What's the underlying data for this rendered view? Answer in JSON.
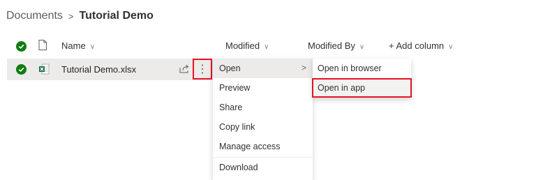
{
  "breadcrumb": {
    "root": "Documents",
    "separator": ">",
    "current": "Tutorial Demo"
  },
  "columns": {
    "name": "Name",
    "modified": "Modified",
    "modified_by": "Modified By",
    "add_column": "+ Add column"
  },
  "icons": {
    "select_all": "checkmark-circle-icon",
    "file_type": "document-icon",
    "excel": "excel-file-icon",
    "share": "share-icon",
    "more": "more-vertical-icon",
    "chevron": "chevron-down-icon",
    "submenu_arrow": "chevron-right-icon"
  },
  "file": {
    "name": "Tutorial Demo.xlsx",
    "more_label": "⋮"
  },
  "context_menu": {
    "items": [
      {
        "label": "Open",
        "arrow": ">"
      },
      {
        "label": "Preview"
      },
      {
        "label": "Share"
      },
      {
        "label": "Copy link"
      },
      {
        "label": "Manage access"
      },
      {
        "label": "Download"
      }
    ]
  },
  "submenu": {
    "items": [
      {
        "label": "Open in browser"
      },
      {
        "label": "Open in app"
      }
    ]
  },
  "colors": {
    "check_green": "#107c10",
    "excel_green": "#217346",
    "highlight_red": "#e81123",
    "row_bg": "#edebe9"
  }
}
